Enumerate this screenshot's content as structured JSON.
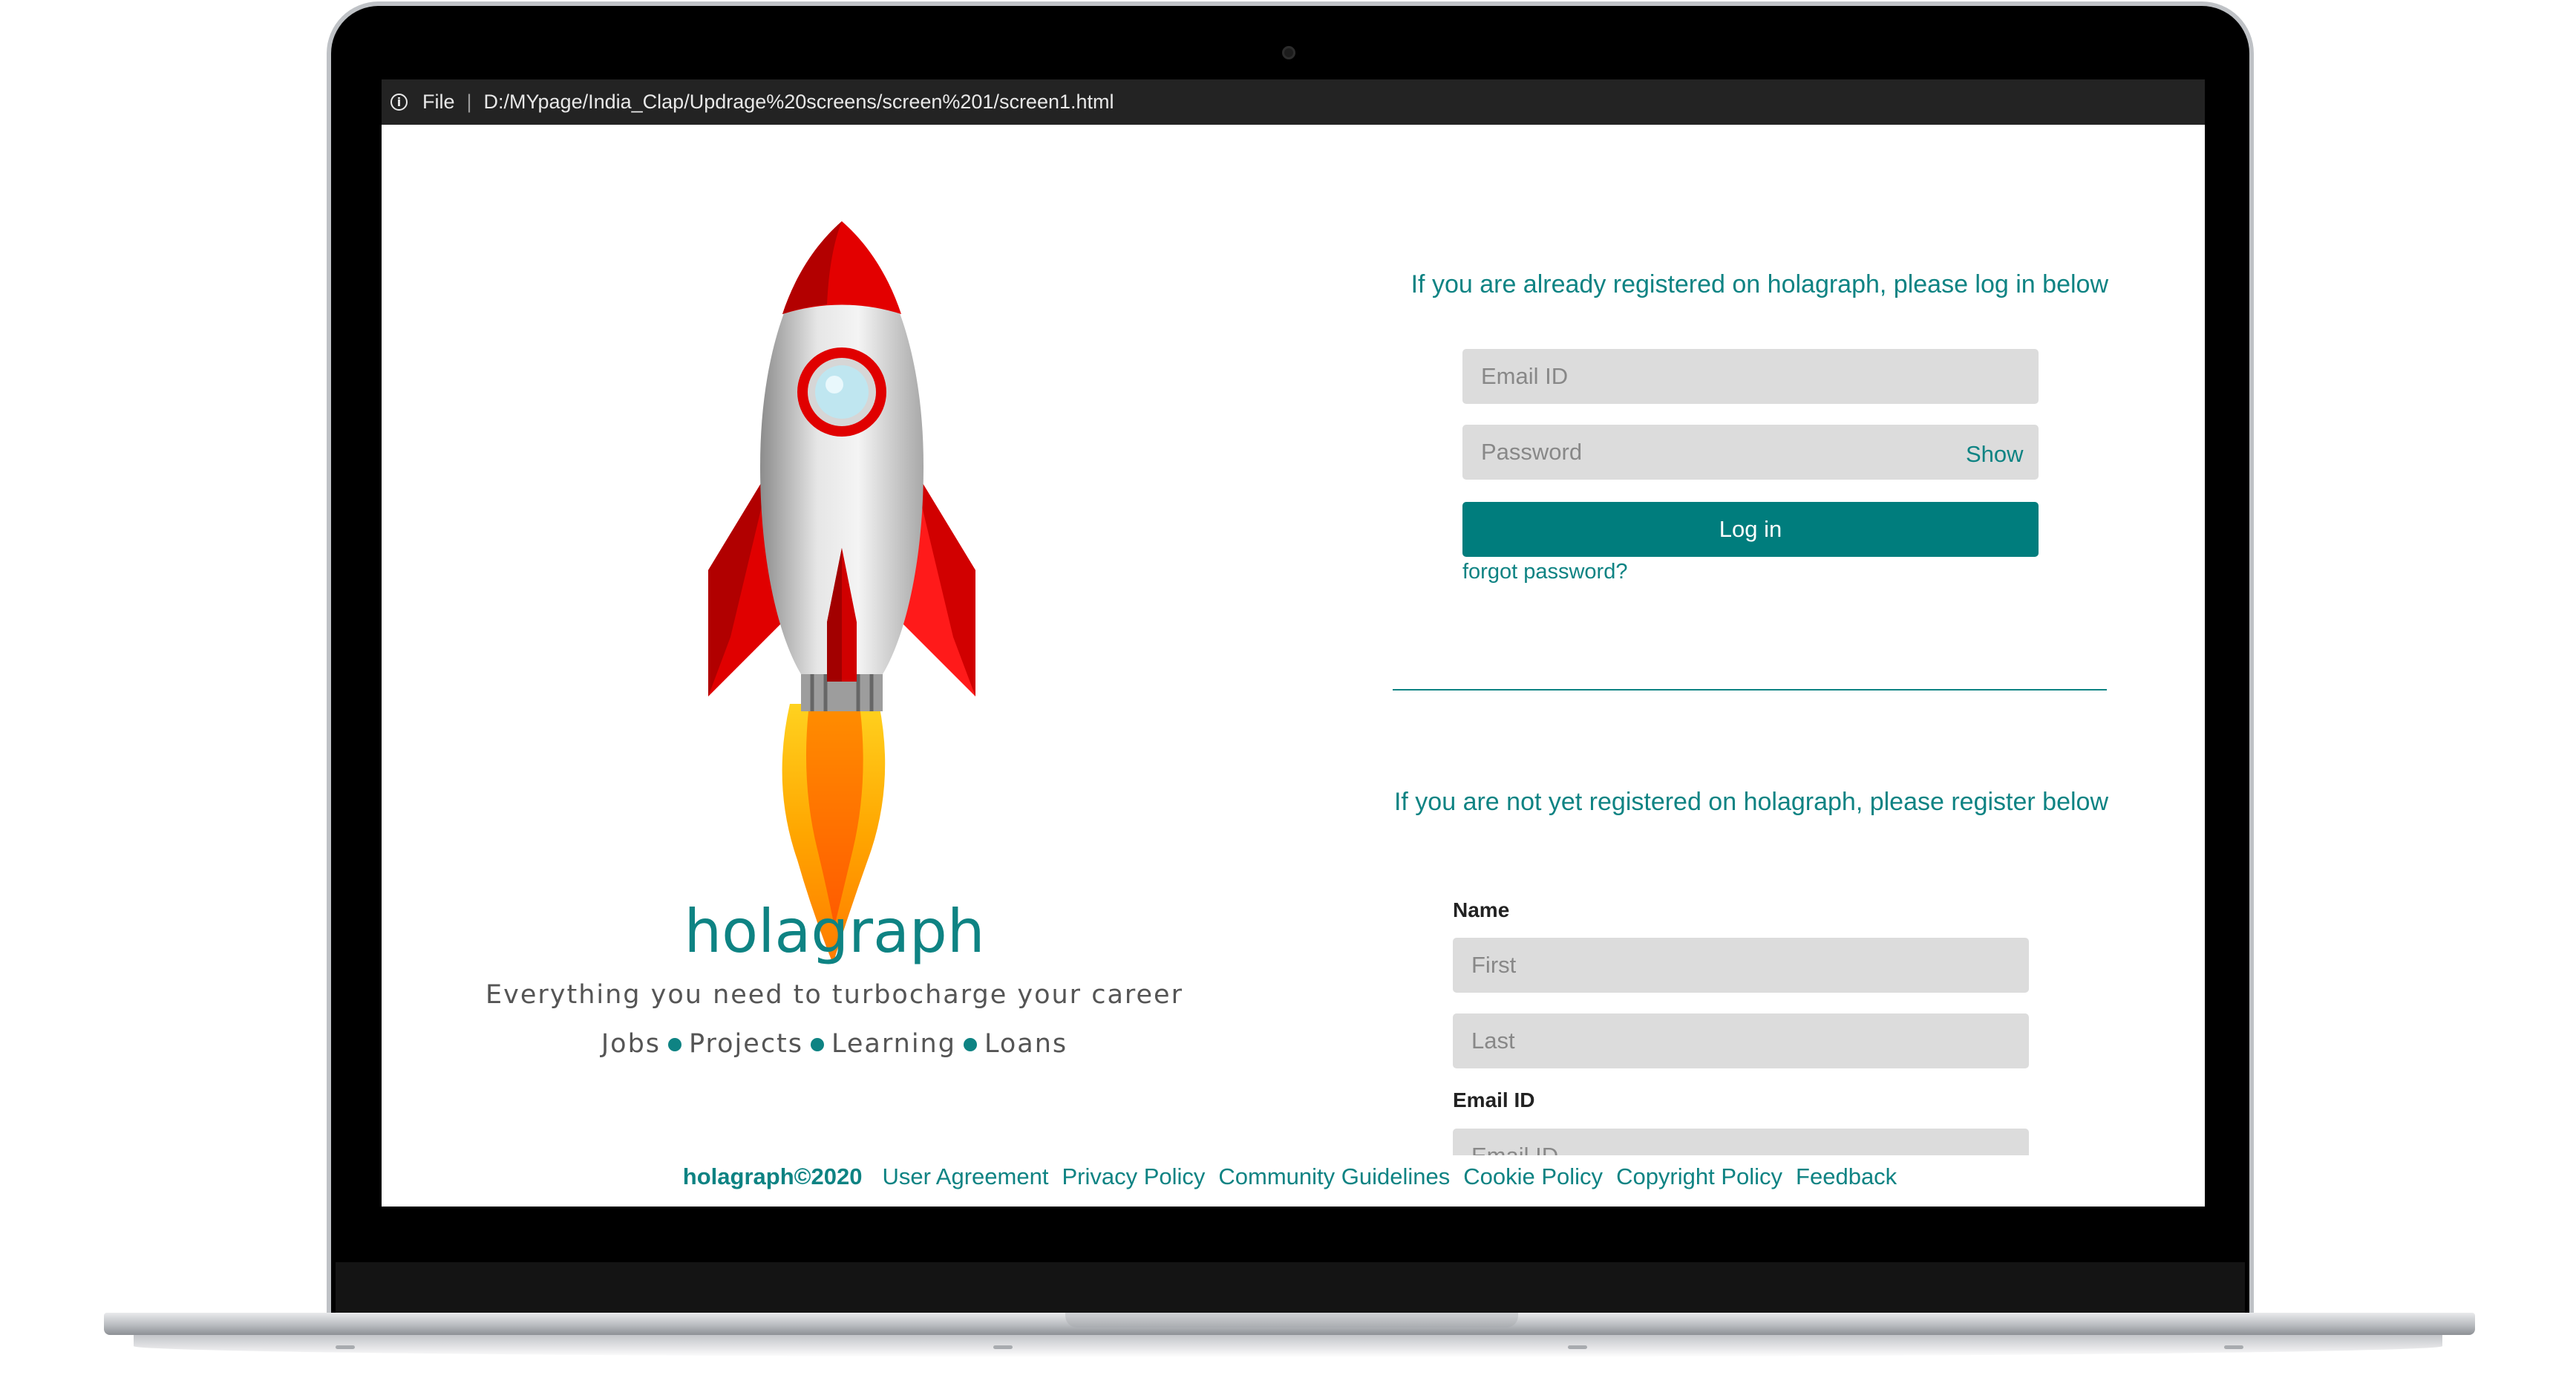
{
  "browser": {
    "file_label": "File",
    "separator": "|",
    "url": "D:/MYpage/India_Clap/Updrage%20screens/screen%201/screen1.html"
  },
  "brand": {
    "name": "holagraph",
    "tagline": "Everything you need to turbocharge your career",
    "categories": [
      "Jobs",
      "Projects",
      "Learning",
      "Loans"
    ]
  },
  "login": {
    "heading": "If you are already registered on holagraph, please log in below",
    "email_placeholder": "Email ID",
    "password_placeholder": "Password",
    "show_label": "Show",
    "button_label": "Log in",
    "forgot_label": "forgot password?"
  },
  "register": {
    "heading": "If you are not yet registered on holagraph, please register below",
    "name_label": "Name",
    "first_placeholder": "First",
    "last_placeholder": "Last",
    "email_label": "Email ID",
    "email_placeholder": "Email ID"
  },
  "footer": {
    "copyright": "holagraph©2020",
    "links": [
      "User Agreement",
      "Privacy Policy",
      "Community Guidelines",
      "Cookie Policy",
      "Copyright Policy",
      "Feedback"
    ]
  },
  "colors": {
    "accent": "#0e8383",
    "button": "#007d7d",
    "field_bg": "#dcdcdc"
  }
}
